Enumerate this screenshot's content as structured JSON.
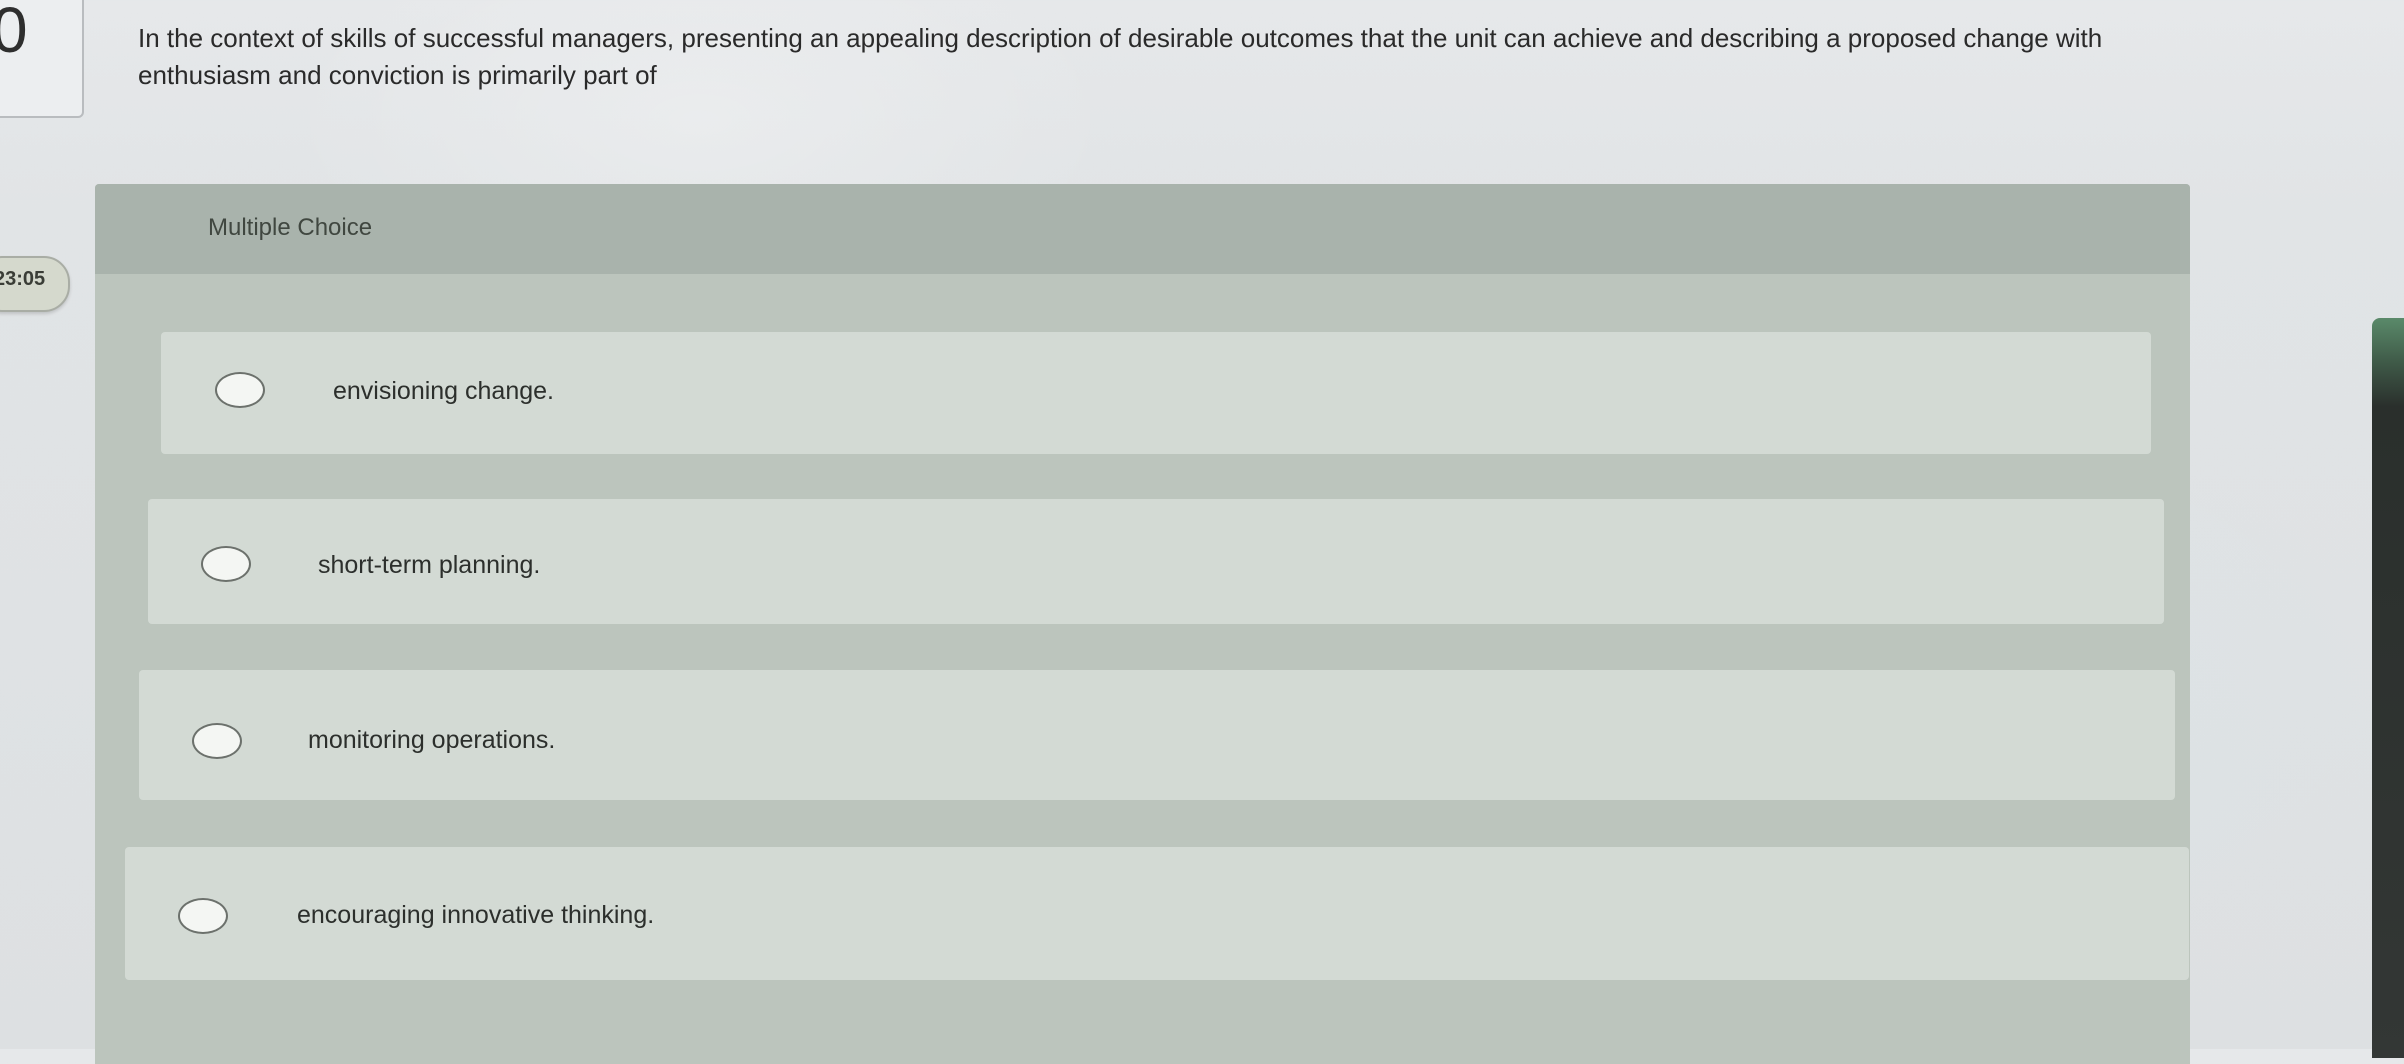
{
  "question": {
    "number": "0",
    "prompt": "In the context of skills of successful managers, presenting an appealing description of desirable outcomes that the unit can achieve and describing a proposed change with enthusiasm and conviction is primarily part of"
  },
  "timer": {
    "text": "23:05"
  },
  "panel": {
    "title": "Multiple Choice"
  },
  "options": [
    {
      "label": "envisioning change."
    },
    {
      "label": "short-term planning."
    },
    {
      "label": "monitoring operations."
    },
    {
      "label": "encouraging innovative thinking."
    }
  ],
  "colors": {
    "page_background": "#e1e4e6",
    "panel_background": "#bcc5bd",
    "panel_header": "#a9b3ac",
    "option_background": "#d3dad4",
    "right_tab": "#2a2f2c"
  }
}
